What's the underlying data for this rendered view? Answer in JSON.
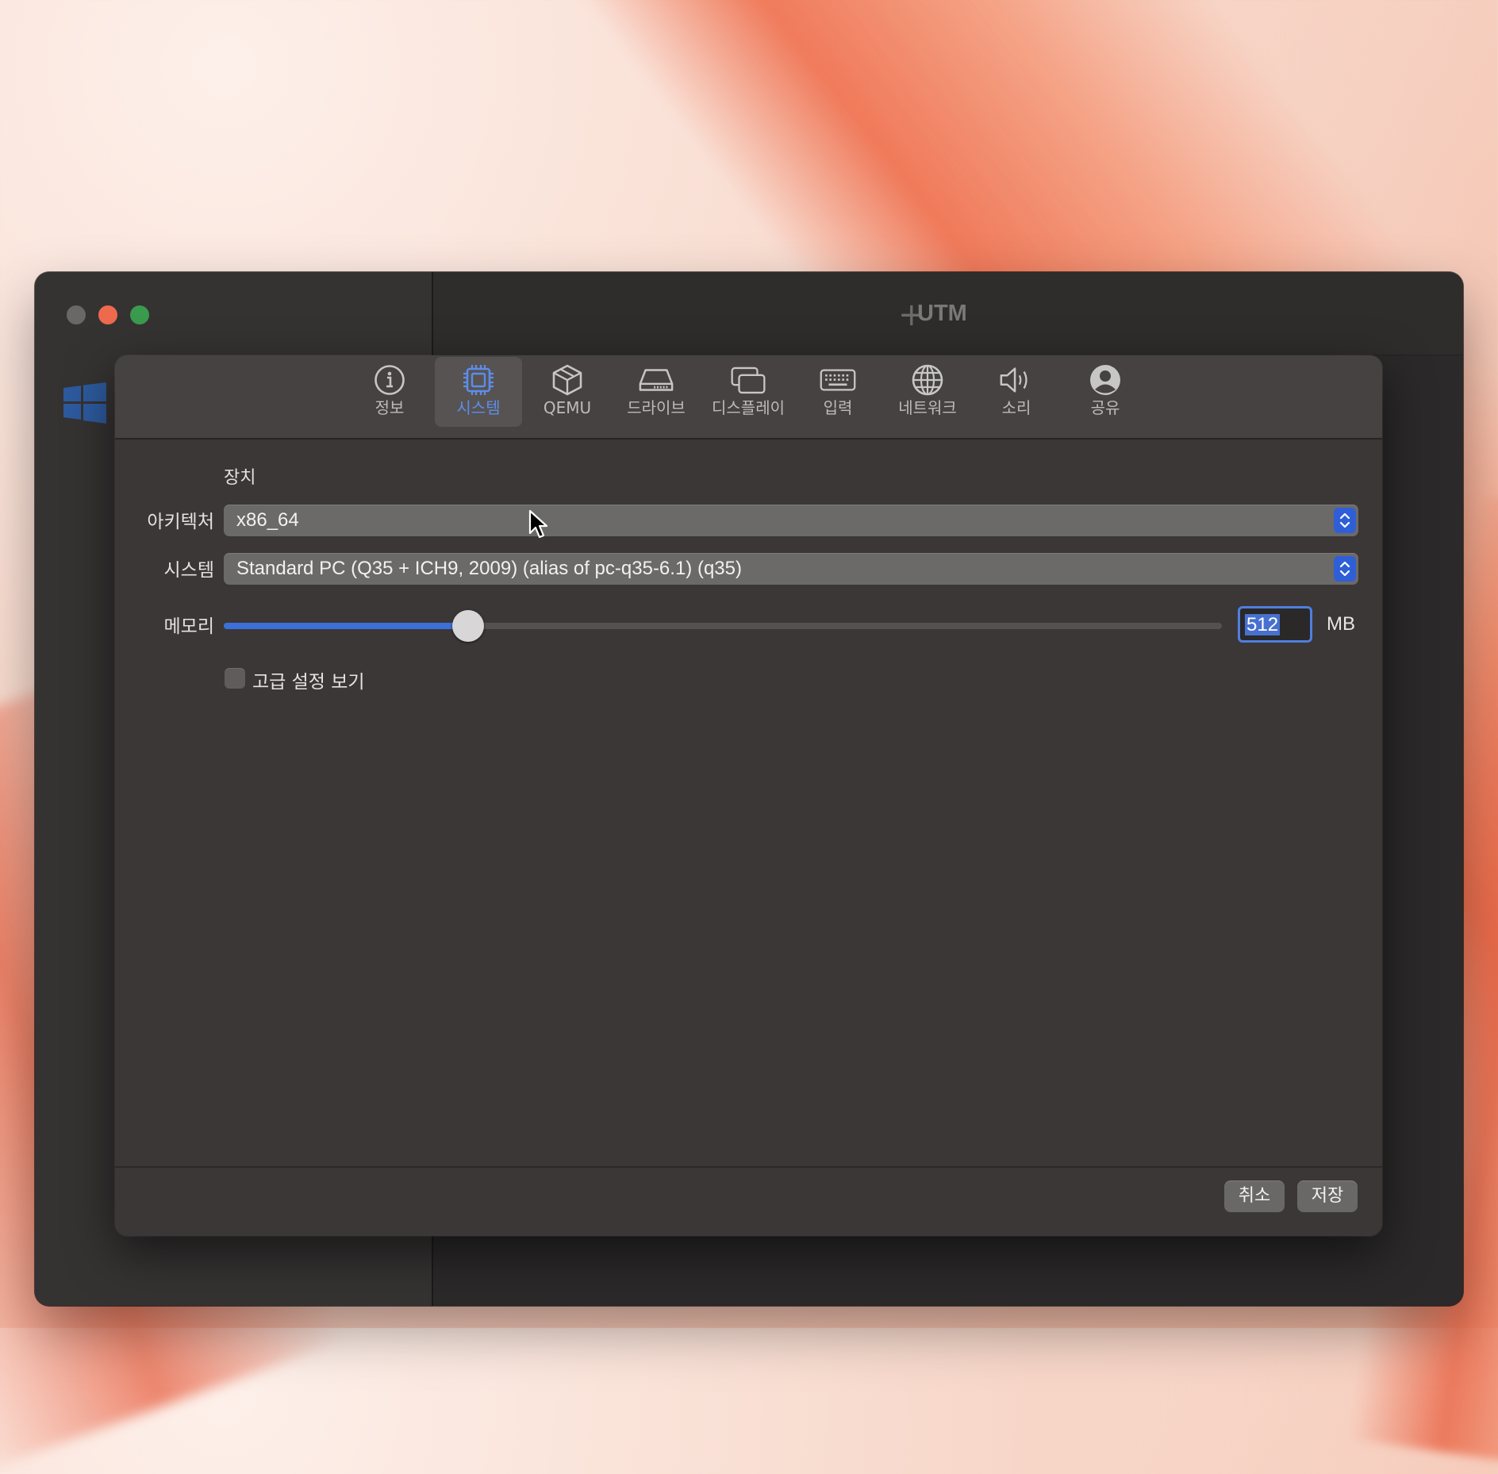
{
  "window": {
    "app_title": "UTM",
    "plus_symbol": "+"
  },
  "toolbar": {
    "tabs": [
      {
        "label": "정보",
        "icon": "info-icon"
      },
      {
        "label": "시스템",
        "icon": "cpu-chip-icon",
        "active": true
      },
      {
        "label": "QEMU",
        "icon": "cube-icon"
      },
      {
        "label": "드라이브",
        "icon": "drive-icon"
      },
      {
        "label": "디스플레이",
        "icon": "display-icon"
      },
      {
        "label": "입력",
        "icon": "keyboard-icon"
      },
      {
        "label": "네트워크",
        "icon": "globe-icon"
      },
      {
        "label": "소리",
        "icon": "speaker-icon"
      },
      {
        "label": "공유",
        "icon": "person-icon"
      }
    ]
  },
  "system": {
    "section_label": "장치",
    "architecture_label": "아키텍처",
    "architecture_value": "x86_64",
    "system_label": "시스템",
    "system_value": "Standard PC (Q35 + ICH9, 2009) (alias of pc-q35-6.1) (q35)",
    "memory_label": "메모리",
    "memory_value": "512",
    "memory_unit": "MB",
    "memory_slider_fraction": 0.245,
    "advanced_label": "고급 설정 보기",
    "advanced_checked": false
  },
  "footer": {
    "cancel_label": "취소",
    "save_label": "저장"
  },
  "colors": {
    "accent": "#3c6fd8",
    "active_tab": "#5d8de8",
    "close": "#ee6a4f",
    "zoom": "#3a9a4e"
  }
}
